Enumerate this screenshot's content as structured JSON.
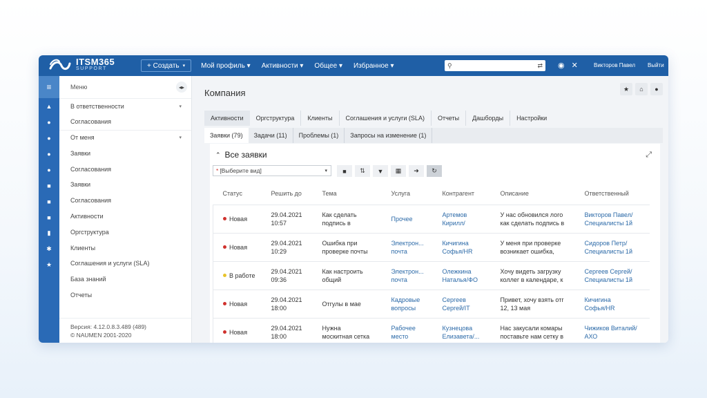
{
  "topbar": {
    "logo_title": "ITSM365",
    "logo_sub": "SUPPORT",
    "create_label": "+ Создать",
    "menu": [
      "Мой профиль",
      "Активности",
      "Общее",
      "Избранное"
    ],
    "search_placeholder": "",
    "user_name": "Викторов Павел",
    "logout": "Выйти"
  },
  "sidemenu": {
    "header": "Меню",
    "items": [
      {
        "label": "В ответственности",
        "caret": true
      },
      {
        "label": "Согласования"
      },
      {
        "label": "От меня",
        "caret": true
      },
      {
        "label": "Заявки"
      },
      {
        "label": "Согласования"
      },
      {
        "label": "Заявки"
      },
      {
        "label": "Согласования"
      },
      {
        "label": "Активности"
      },
      {
        "label": "Оргструктура"
      },
      {
        "label": "Клиенты"
      },
      {
        "label": "Соглашения и услуги (SLA)"
      },
      {
        "label": "База знаний"
      },
      {
        "label": "Отчеты"
      }
    ],
    "version_line1": "Версия: 4.12.0.8.3.489 (489)",
    "version_line2": "© NAUMEN 2001-2020"
  },
  "main": {
    "title": "Компания",
    "tabs": [
      "Активности",
      "Оргструктура",
      "Клиенты",
      "Соглашения и услуги (SLA)",
      "Отчеты",
      "Дашборды",
      "Настройки"
    ],
    "subtabs": [
      "Заявки (79)",
      "Задачи (11)",
      "Проблемы (1)",
      "Запросы на изменение (1)"
    ],
    "panel_title": "Все заявки",
    "view_select": "[Выберите вид]",
    "columns": [
      "Статус",
      "Решить до",
      "Тема",
      "Услуга",
      "Контрагент",
      "Описание",
      "Ответственный"
    ],
    "rows": [
      {
        "status": "Новая",
        "status_color": "#d0312d",
        "date": "29.04.2021",
        "time": "10:57",
        "topic1": "Как сделать",
        "topic2": "подпись в",
        "service1": "Прочее",
        "service2": "",
        "agent1": "Артемов",
        "agent2": "Кирилл/",
        "desc1": "У нас обновился лого",
        "desc2": "как сделать подпись в",
        "resp1": "Викторов Павел/",
        "resp2": "Специалисты 1й"
      },
      {
        "status": "Новая",
        "status_color": "#d0312d",
        "date": "29.04.2021",
        "time": "10:29",
        "topic1": "Ошибка при",
        "topic2": "проверке почты",
        "service1": "Электрон...",
        "service2": "почта",
        "agent1": "Кичигина",
        "agent2": "Софья/HR",
        "desc1": "У меня при проверке",
        "desc2": "возникает ошибка,",
        "resp1": "Сидоров Петр/",
        "resp2": "Специалисты 1й"
      },
      {
        "status": "В работе",
        "status_color": "#e8c32a",
        "date": "29.04.2021",
        "time": "09:36",
        "topic1": "Как настроить",
        "topic2": "общий",
        "service1": "Электрон...",
        "service2": "почта",
        "agent1": "Олежкина",
        "agent2": "Наталья/ФО",
        "desc1": "Хочу видеть загрузку",
        "desc2": "коллег в календаре, к",
        "resp1": "Сергеев Сергей/",
        "resp2": "Специалисты 1й"
      },
      {
        "status": "Новая",
        "status_color": "#d0312d",
        "date": "29.04.2021",
        "time": "18:00",
        "topic1": "Отгулы в мае",
        "topic2": "",
        "service1": "Кадровые",
        "service2": "вопросы",
        "agent1": "Сергеев",
        "agent2": "Сергей/IT",
        "desc1": "Привет, хочу взять отг",
        "desc2": "12, 13 мая",
        "resp1": "Кичигина",
        "resp2": "Софья/HR"
      },
      {
        "status": "Новая",
        "status_color": "#d0312d",
        "date": "29.04.2021",
        "time": "18:00",
        "topic1": "Нужна",
        "topic2": "москитная сетка",
        "service1": "Рабочее",
        "service2": "место",
        "agent1": "Кузнецова",
        "agent2": "Елизавета/...",
        "desc1": "Нас закусали комары",
        "desc2": "поставьте нам сетку в",
        "resp1": "Чижиков Виталий/",
        "resp2": "АХО"
      }
    ]
  },
  "colors": {
    "topbar": "#1f5fa6",
    "rail": "#2a6ab6",
    "link": "#2c6aa8",
    "status_new": "#d0312d",
    "status_work": "#e8c32a"
  },
  "icons": [
    "logo-icon",
    "search-icon",
    "filter-settings-icon",
    "eye-icon",
    "tools-icon",
    "menu-icon",
    "star-icon",
    "home-icon",
    "bulb-icon",
    "expand-icon"
  ]
}
